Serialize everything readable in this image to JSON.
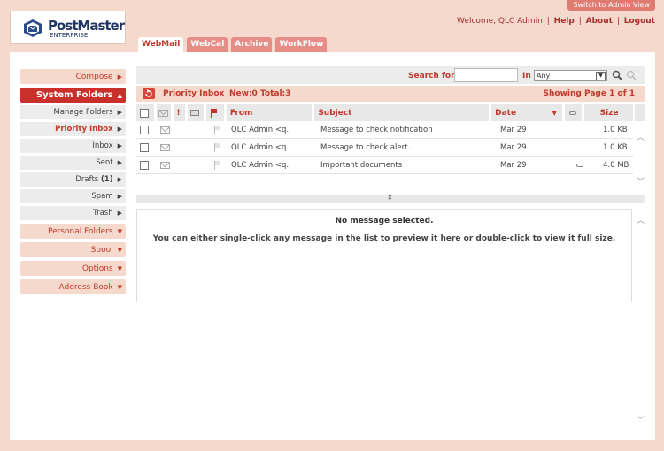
{
  "app": {
    "logo_title": "PostMaster",
    "logo_subtitle": "ENTERPRISE",
    "admin_button": "Switch to Admin View",
    "welcome": "Welcome, QLC Admin",
    "links": {
      "help": "Help",
      "about": "About",
      "logout": "Logout"
    }
  },
  "tabs": [
    "WebMail",
    "WebCal",
    "Archive",
    "WorkFlow"
  ],
  "sidebar": {
    "compose": "Compose",
    "system_folders": "System Folders",
    "sub": {
      "manage": "Manage Folders",
      "priority": "Priority Inbox",
      "inbox": "Inbox",
      "sent": "Sent",
      "drafts": "Drafts",
      "drafts_count": "(1)",
      "spam": "Spam",
      "trash": "Trash"
    },
    "personal_folders": "Personal Folders",
    "spool": "Spool",
    "options": "Options",
    "address_book": "Address Book"
  },
  "search": {
    "label": "Search for",
    "value": "",
    "in_label": "In",
    "in_value": "Any"
  },
  "info": {
    "folder": "Priority Inbox",
    "counts": "New:0 Total:3",
    "page": "Showing Page 1 of 1"
  },
  "table": {
    "headers": {
      "from": "From",
      "subject": "Subject",
      "date": "Date",
      "size": "Size"
    },
    "rows": [
      {
        "from": "QLC Admin <q..",
        "subject": "Message to check notification",
        "date": "Mar 29",
        "attach": false,
        "size": "1.0 KB"
      },
      {
        "from": "QLC Admin <q..",
        "subject": "Message to check alert..",
        "date": "Mar 29",
        "attach": false,
        "size": "1.0 KB"
      },
      {
        "from": "QLC Admin <q..",
        "subject": "Important documents",
        "date": "Mar 29",
        "attach": true,
        "size": "4.0 MB"
      }
    ]
  },
  "preview": {
    "title": "No message selected.",
    "message": "You can either single-click any message in the list to preview it here or double-click to view it full size."
  },
  "colors": {
    "accent": "#c9302c",
    "background": "#f6d9cd",
    "tab": "#e58d86"
  }
}
